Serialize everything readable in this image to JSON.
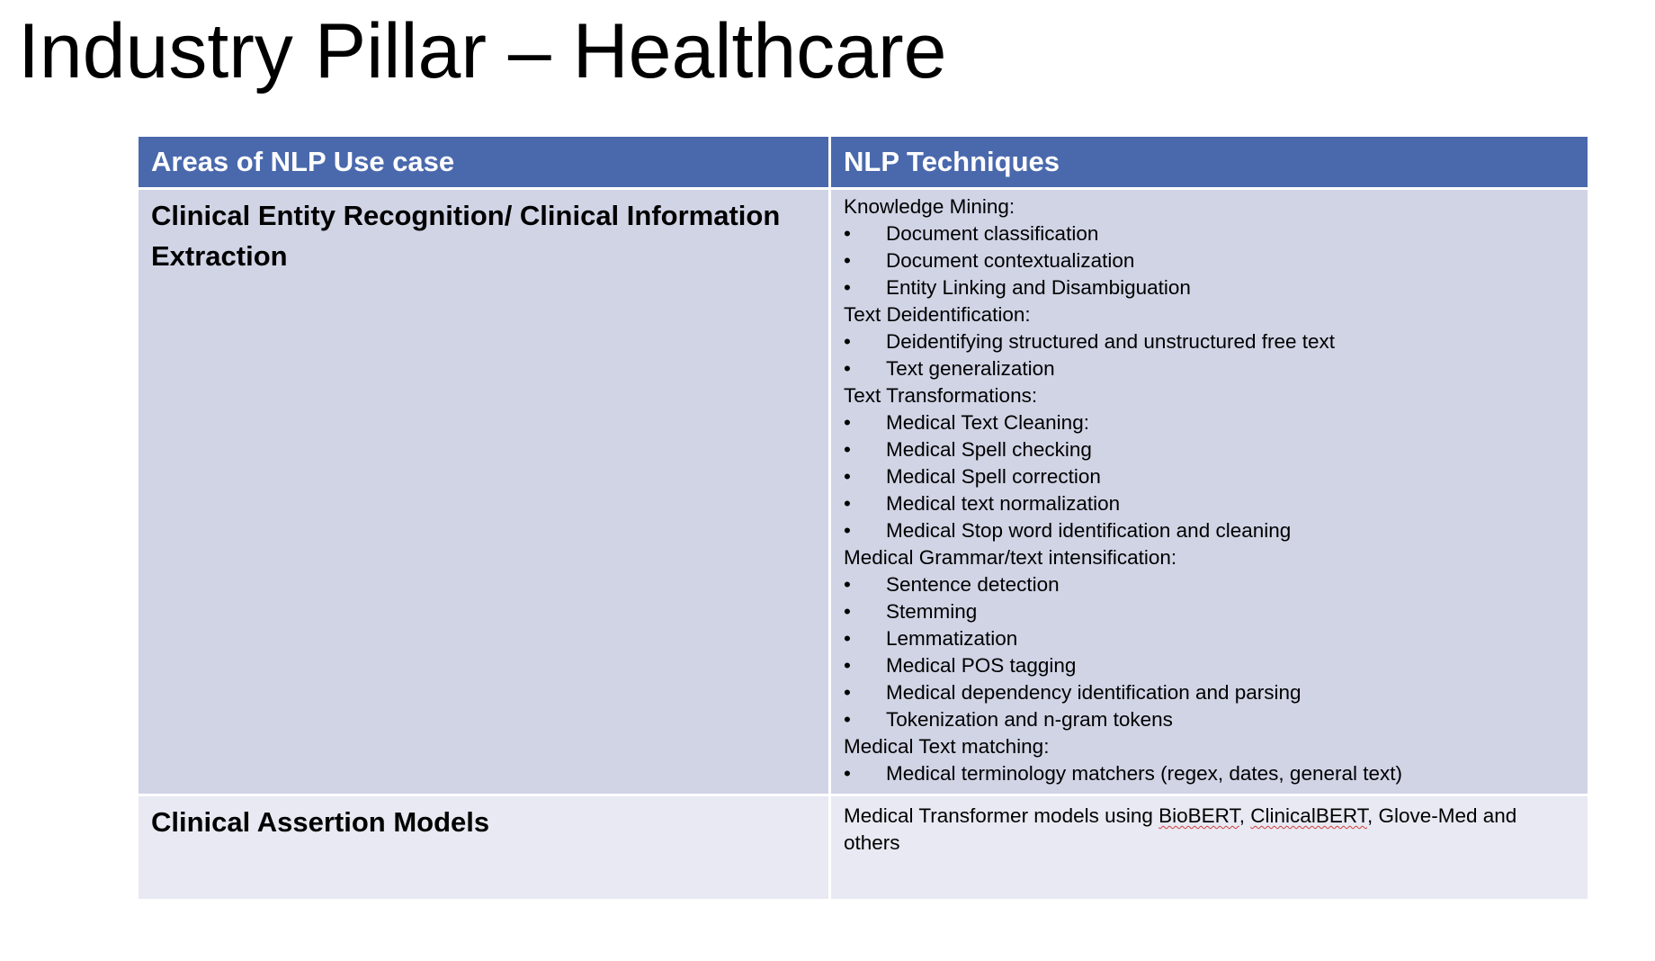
{
  "slide": {
    "title": "Industry Pillar – Healthcare"
  },
  "table": {
    "headers": [
      "Areas of NLP Use case",
      "NLP Techniques"
    ],
    "colors": {
      "header_bg": "#4a69ad",
      "row1_bg": "#d0d4e5",
      "row2_bg": "#e8e9f2"
    },
    "rows": [
      {
        "area": "Clinical Entity Recognition/ Clinical Information Extraction",
        "techniques": [
          {
            "type": "heading",
            "text": "Knowledge Mining:"
          },
          {
            "type": "bullet",
            "text": "Document classification"
          },
          {
            "type": "bullet",
            "text": "Document contextualization"
          },
          {
            "type": "bullet",
            "text": "Entity Linking and Disambiguation"
          },
          {
            "type": "heading",
            "text": "Text Deidentification:"
          },
          {
            "type": "bullet",
            "text": "Deidentifying structured and unstructured free text"
          },
          {
            "type": "bullet",
            "text": "Text generalization"
          },
          {
            "type": "heading",
            "text": "Text Transformations:"
          },
          {
            "type": "bullet",
            "text": "Medical Text Cleaning:"
          },
          {
            "type": "bullet",
            "text": "Medical Spell checking"
          },
          {
            "type": "bullet",
            "text": "Medical Spell correction"
          },
          {
            "type": "bullet",
            "text": "Medical text normalization"
          },
          {
            "type": "bullet",
            "text": "Medical Stop word identification and cleaning"
          },
          {
            "type": "heading",
            "text": "Medical Grammar/text intensification:"
          },
          {
            "type": "bullet",
            "text": "Sentence detection"
          },
          {
            "type": "bullet",
            "text": "Stemming"
          },
          {
            "type": "bullet",
            "text": "Lemmatization"
          },
          {
            "type": "bullet",
            "text": "Medical POS tagging"
          },
          {
            "type": "bullet",
            "text": "Medical dependency identification and parsing"
          },
          {
            "type": "bullet",
            "text": "Tokenization and n-gram tokens"
          },
          {
            "type": "heading",
            "text": "Medical Text matching:"
          },
          {
            "type": "bullet",
            "text": "Medical terminology matchers (regex, dates, general text)"
          }
        ]
      },
      {
        "area": "Clinical Assertion Models",
        "techniques_parts": {
          "prefix": "Medical Transformer models using ",
          "term1": "BioBERT",
          "sep": ", ",
          "term2": "ClinicalBERT",
          "suffix": ", Glove-Med and others"
        }
      }
    ],
    "bullet_glyph": "•"
  }
}
